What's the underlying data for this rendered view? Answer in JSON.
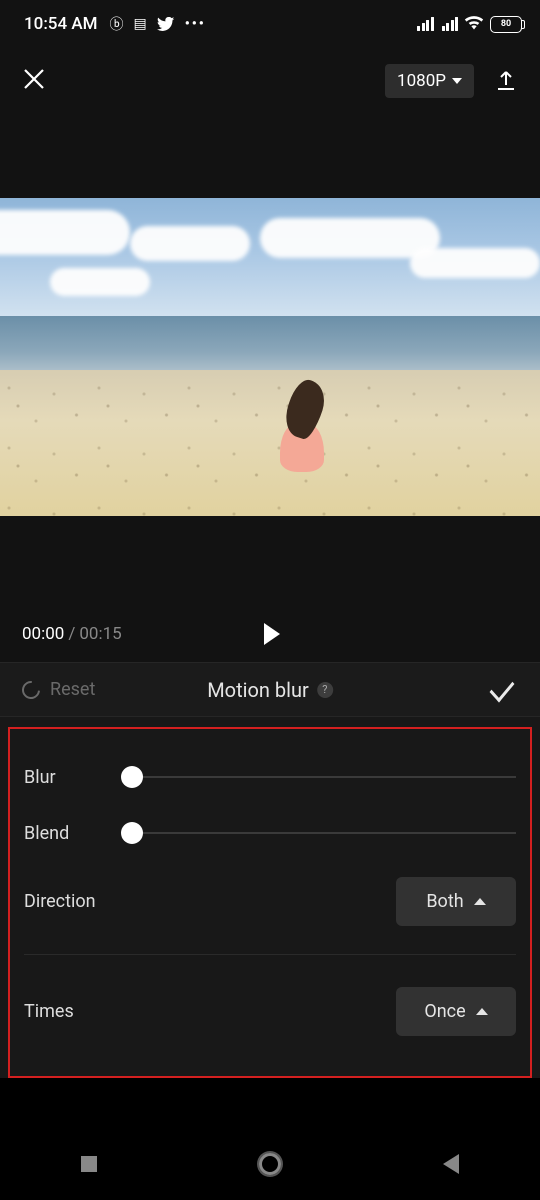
{
  "status": {
    "time": "10:54 AM",
    "icons": [
      "b-circle-icon",
      "card-icon",
      "twitter-icon",
      "more-icon"
    ],
    "battery": "80"
  },
  "toolbar": {
    "quality": "1080P"
  },
  "playback": {
    "current": "00:00",
    "duration": "00:15"
  },
  "effect": {
    "reset_label": "Reset",
    "title": "Motion blur",
    "help": "?"
  },
  "controls": {
    "blur": {
      "label": "Blur",
      "value": 0,
      "min": 0,
      "max": 100
    },
    "blend": {
      "label": "Blend",
      "value": 0,
      "min": 0,
      "max": 100
    },
    "direction": {
      "label": "Direction",
      "value": "Both"
    },
    "times": {
      "label": "Times",
      "value": "Once"
    }
  }
}
